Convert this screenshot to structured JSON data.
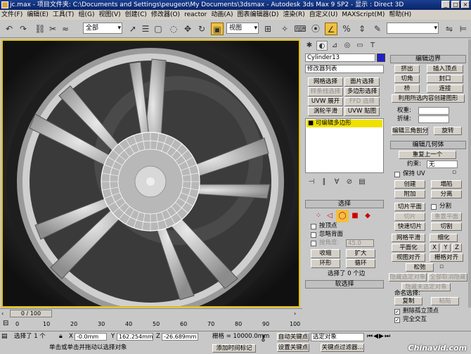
{
  "titlebar": {
    "title": "jc.max  - 项目文件夹: C:\\Documents and Settings\\peugeot\\My Documents\\3dsmax  - Autodesk 3ds Max 9 SP2  - 显示 : Direct 3D",
    "minimize": "_",
    "maximize": "□",
    "close": "×"
  },
  "menu": [
    "文件(F)",
    "编辑(E)",
    "工具(T)",
    "组(G)",
    "视图(V)",
    "创建(C)",
    "修改器(O)",
    "reactor",
    "动画(A)",
    "图表编辑器(D)",
    "渲染(R)",
    "自定义(U)",
    "MAXScript(M)",
    "帮助(H)"
  ],
  "toolbar": {
    "selection_filter": "全部",
    "coord_system": "视图",
    "named_selection": ""
  },
  "command_panel": {
    "object_name": "Cylinder13",
    "object_color": "#2020c8",
    "modifier_list": "修改器列表",
    "modifier_buttons": [
      "网格选择",
      "面片选择",
      "样条线选择",
      "多边形选择",
      "UVW 展开",
      "FFD 选择",
      "涡轮平滑",
      "UVW 贴图"
    ],
    "stack_item": "可编辑多边形",
    "selection": {
      "header": "选择",
      "by_vertex": "按顶点",
      "ignore_backfacing": "忽略背面",
      "by_angle": "按角度:",
      "angle_value": "45.0",
      "shrink": "收缩",
      "grow": "扩大",
      "ring": "环形",
      "loop": "循环",
      "status": "选择了 0 个边"
    },
    "soft_selection": "软选择"
  },
  "edit_edges": {
    "header": "编辑边界",
    "extrude": "挤出",
    "insert_vertex": "插入顶点",
    "chamfer": "切角",
    "cap": "封口",
    "bridge": "桥",
    "connect": "连接",
    "create_shape": "利用所选内容创建图形",
    "weight_label": "权重:",
    "crease_label": "折缝:",
    "edit_tri": "编辑三角剖分",
    "turn": "旋转"
  },
  "edit_geometry": {
    "header": "编辑几何体",
    "repeat_last": "重复上一个",
    "constraints_label": "约束:",
    "constraints_value": "无",
    "preserve_uv": "保持 UV",
    "create": "创建",
    "collapse": "塌陷",
    "attach": "附加",
    "detach": "分离",
    "slice_plane": "切片平面",
    "split": "分割",
    "slice": "切片",
    "reset_plane": "重置平面",
    "quickslice": "快速切片",
    "cut": "切割",
    "meshsmooth": "网格平滑",
    "tessellate": "细化",
    "make_planar": "平面化",
    "x": "X",
    "y": "Y",
    "z": "Z",
    "view_align": "视图对齐",
    "grid_align": "栅格对齐",
    "relax": "松弛",
    "hide_selected": "隐藏选定对象",
    "unhide_all": "全部取消隐藏",
    "hide_unselected": "隐藏未选定对象",
    "named_sel_label": "命名选择:",
    "copy": "复制",
    "paste": "粘贴",
    "delete_isolated": "删除孤立顶点",
    "full_interop": "完全交互"
  },
  "timeline": {
    "frame": "0 / 100",
    "ticks": [
      "0",
      "10",
      "20",
      "30",
      "40",
      "50",
      "60",
      "70",
      "80",
      "90",
      "100"
    ]
  },
  "status": {
    "selected": "选择了 1 个",
    "x_value": "-0.0mm",
    "y_value": "162.254mm",
    "z_value": "-26.689mm",
    "grid": "栅格 = 10000.0mm",
    "prompt": "单击或单击并拖动以选择对象",
    "add_time_tag": "添加时间标记",
    "auto_key": "自动关键点",
    "set_key": "设置关键点",
    "selected_obj": "选定对象",
    "key_filters": "关键点过滤器..."
  },
  "watermark": "Chinavid.com"
}
